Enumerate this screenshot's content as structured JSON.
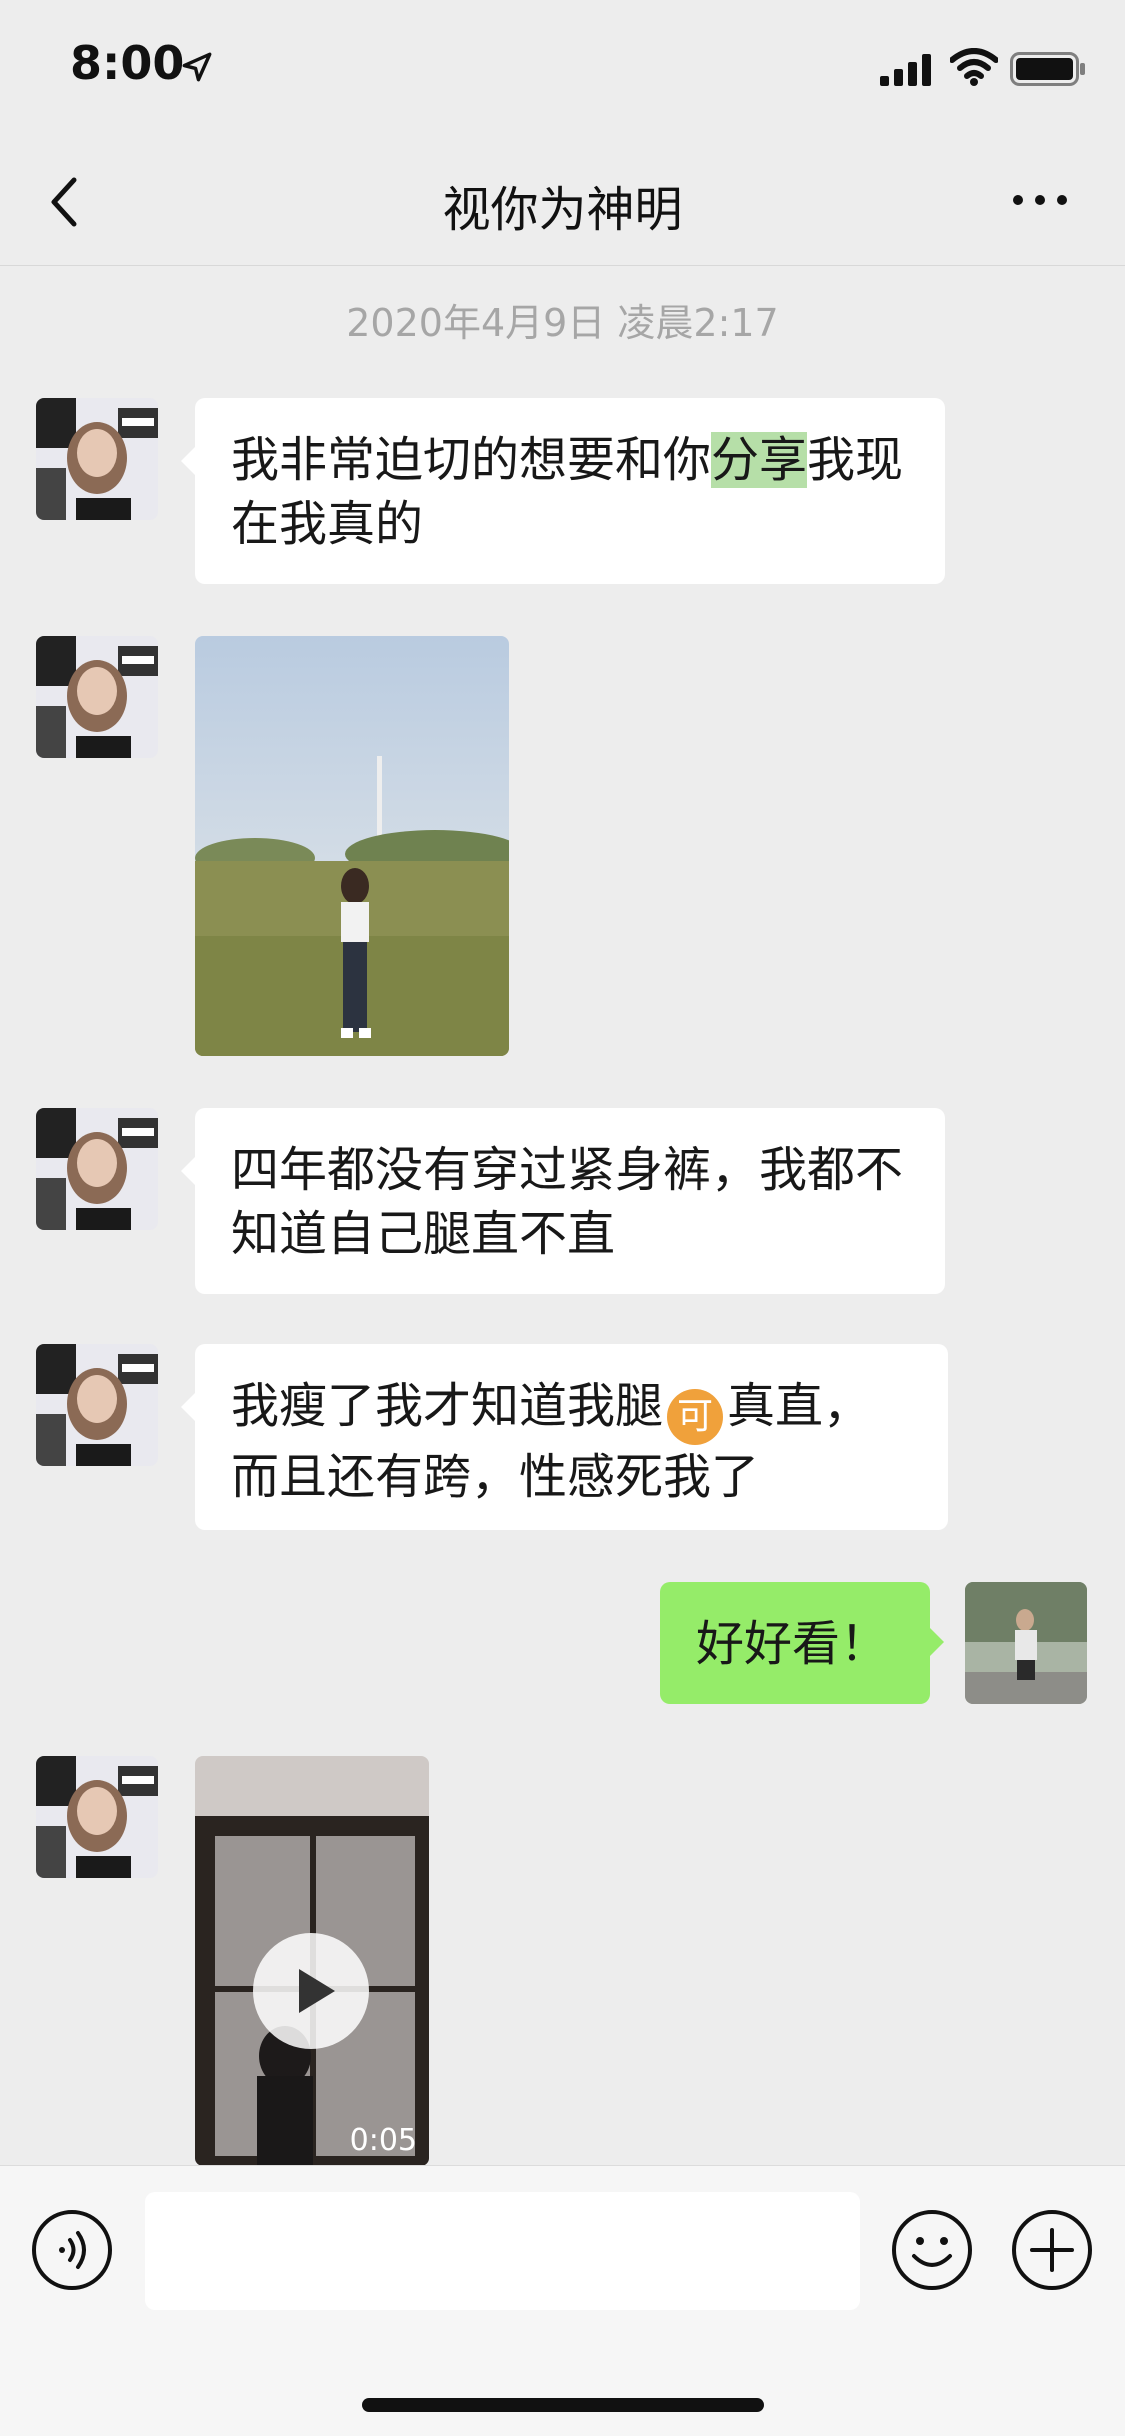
{
  "status_bar": {
    "time": "8:00",
    "location_icon": "location-arrow-icon",
    "signal_icon": "cellular-signal-icon",
    "wifi_icon": "wifi-icon",
    "battery_icon": "battery-icon"
  },
  "nav": {
    "title": "视你为神明",
    "back_icon": "chevron-left-icon",
    "more_icon": "more-dots-icon"
  },
  "chat": {
    "timestamp": "2020年4月9日 凌晨2:17",
    "messages": [
      {
        "sender": "contact",
        "type": "text",
        "text_before": "我非常迫切的想要和你",
        "highlight": "分享",
        "text_after": "我现在我真的"
      },
      {
        "sender": "contact",
        "type": "image",
        "description_icon": "photo-thumbnail"
      },
      {
        "sender": "contact",
        "type": "text",
        "text": "四年都没有穿过紧身裤，我都不知道自己腿直不直"
      },
      {
        "sender": "contact",
        "type": "text",
        "text_before": "我瘦了我才知道我腿",
        "emoji": "可",
        "text_after": "真直，而且还有跨，性感死我了"
      },
      {
        "sender": "me",
        "type": "text",
        "text": "好好看！"
      },
      {
        "sender": "contact",
        "type": "video",
        "duration": "0:05"
      }
    ]
  },
  "input_bar": {
    "voice_icon": "voice-input-icon",
    "input_placeholder": "",
    "emoji_icon": "emoji-smile-icon",
    "plus_icon": "plus-circle-icon"
  },
  "colors": {
    "background": "#ededed",
    "bubble_contact": "#ffffff",
    "bubble_me": "#95ec69",
    "highlight": "#b6dfa8",
    "timestamp": "#a6a6a6"
  }
}
